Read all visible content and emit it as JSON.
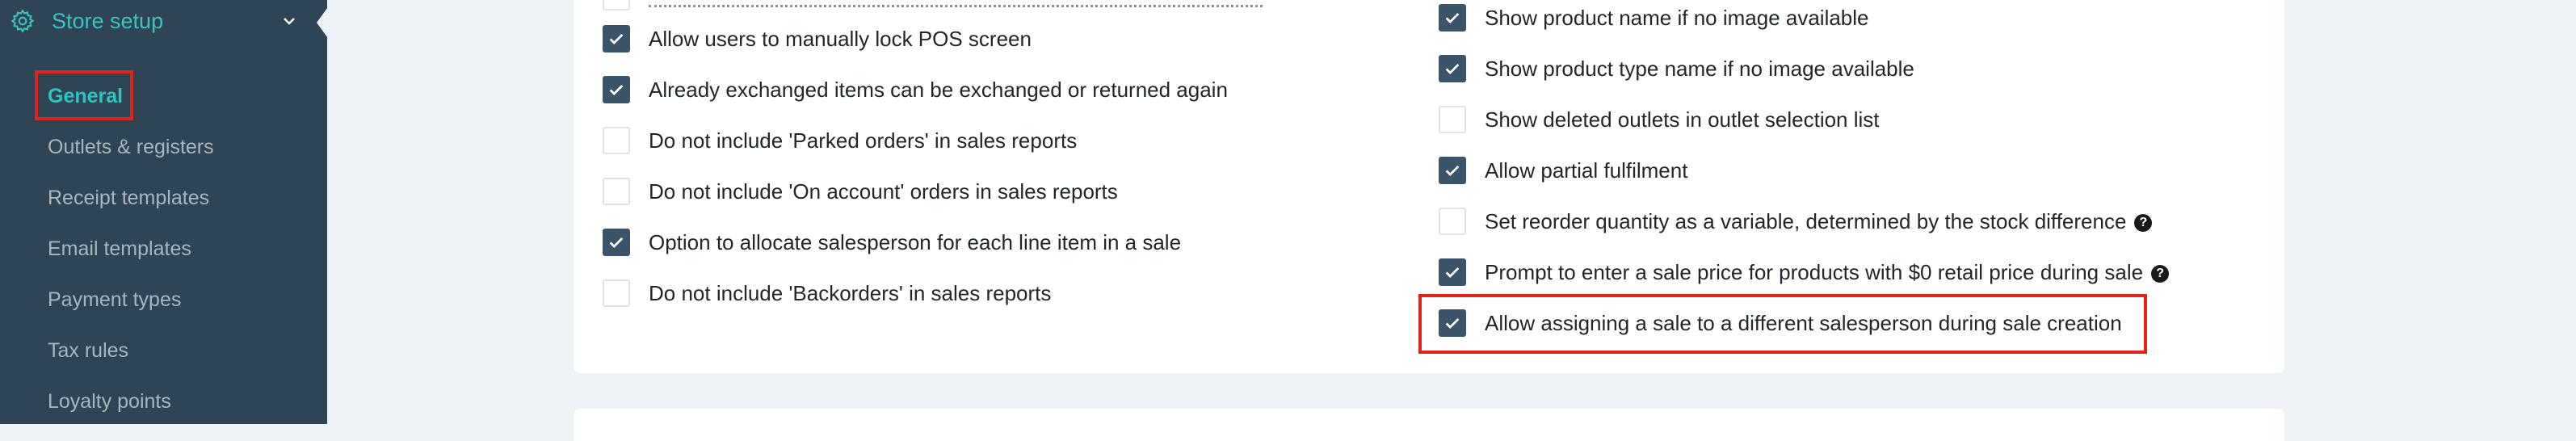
{
  "sidebar": {
    "section_title": "Store setup",
    "section_icon": "gear-icon",
    "expand_icon": "chevron-down-icon",
    "accent_color": "#3cc2bf",
    "items": [
      {
        "label": "General",
        "active": true
      },
      {
        "label": "Outlets & registers"
      },
      {
        "label": "Receipt templates"
      },
      {
        "label": "Email templates"
      },
      {
        "label": "Payment types"
      },
      {
        "label": "Tax rules"
      },
      {
        "label": "Loyalty points"
      }
    ]
  },
  "settings": {
    "left": [
      {
        "label": "Allow users to manually lock POS screen",
        "checked": true
      },
      {
        "label": "Already exchanged items can be exchanged or returned again",
        "checked": true
      },
      {
        "label": "Do not include 'Parked orders' in sales reports",
        "checked": false
      },
      {
        "label": "Do not include 'On account' orders in sales reports",
        "checked": false
      },
      {
        "label": "Option to allocate salesperson for each line item in a sale",
        "checked": true
      },
      {
        "label": "Do not include 'Backorders' in sales reports",
        "checked": false
      }
    ],
    "right": [
      {
        "label": "Show product name if no image available",
        "checked": true
      },
      {
        "label": "Show product type name if no image available",
        "checked": true
      },
      {
        "label": "Show deleted outlets in outlet selection list",
        "checked": false
      },
      {
        "label": "Allow partial fulfilment",
        "checked": true
      },
      {
        "label": "Set reorder quantity as a variable, determined by the stock difference",
        "checked": false,
        "help": true
      },
      {
        "label": "Prompt to enter a sale price for products with $0 retail price during sale",
        "checked": true,
        "help": true
      },
      {
        "label": "Allow assigning a sale to a different salesperson during sale creation",
        "checked": true,
        "highlighted": true
      }
    ],
    "help_glyph": "?"
  },
  "colors": {
    "sidebar_bg": "#2f4556",
    "checkbox_checked": "#3b546a",
    "highlight": "#e0231b"
  }
}
